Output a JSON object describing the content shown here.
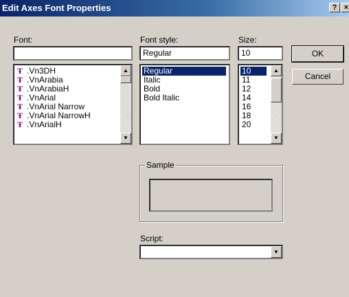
{
  "window": {
    "title": "Edit Axes Font Properties",
    "help_button": "?",
    "close_button": "×"
  },
  "font": {
    "label": "Font:",
    "value": "",
    "items": [
      ".Vn3DH",
      ".VnArabia",
      ".VnArabiaH",
      ".VnArial",
      ".VnArial Narrow",
      ".VnArial NarrowH",
      ".VnArialH"
    ],
    "icon": "truetype-font-icon"
  },
  "font_style": {
    "label": "Font style:",
    "value": "Regular",
    "items": [
      "Regular",
      "Italic",
      "Bold",
      "Bold Italic"
    ],
    "selected": "Regular"
  },
  "size": {
    "label": "Size:",
    "value": "10",
    "items": [
      "10",
      "11",
      "12",
      "14",
      "16",
      "18",
      "20"
    ],
    "selected": "10"
  },
  "buttons": {
    "ok": "OK",
    "cancel": "Cancel"
  },
  "sample": {
    "caption": "Sample"
  },
  "script": {
    "label": "Script:",
    "value": ""
  },
  "colors": {
    "title_bar_start": "#0a246a",
    "title_bar_end": "#a6caf0",
    "dialog_face": "#d4d0c8",
    "selection": "#0a246a",
    "font_icon": "#800080"
  }
}
